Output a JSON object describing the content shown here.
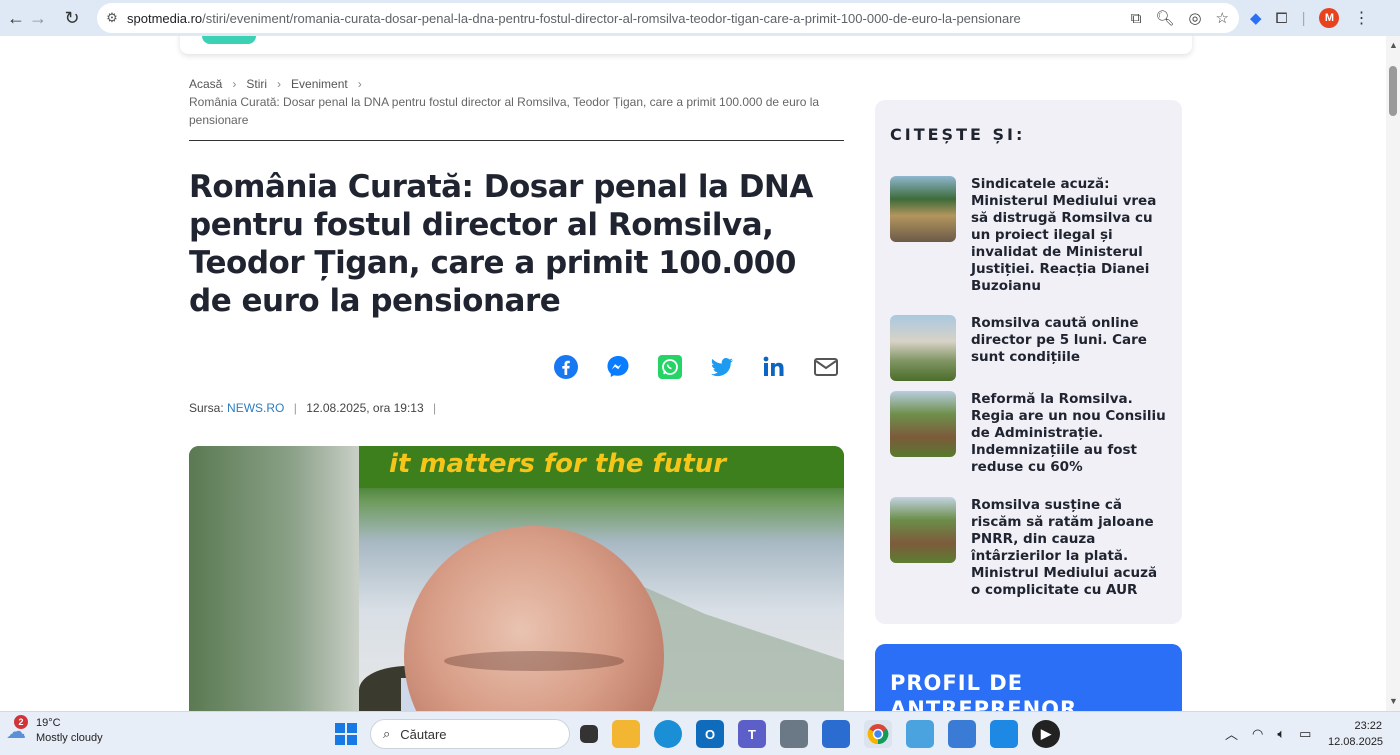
{
  "browser": {
    "url_host": "spotmedia.ro",
    "url_path": "/stiri/eveniment/romania-curata-dosar-penal-la-dna-pentru-fostul-director-al-romsilva-teodor-tigan-care-a-primit-100-000-de-euro-la-pensionare",
    "profile_initial": "M"
  },
  "breadcrumb": {
    "items": [
      "Acasă",
      "Stiri",
      "Eveniment"
    ],
    "separator": "›",
    "current": "România Curată: Dosar penal la DNA pentru fostul director al Romsilva, Teodor Țigan, care a primit 100.000 de euro la pensionare"
  },
  "article": {
    "title": "România Curată: Dosar penal la DNA pentru fostul director al Romsilva, Teodor Țigan, care a primit 100.000 de euro la pensionare",
    "source_label": "Sursa:",
    "source_name": "NEWS.RO",
    "date": "12.08.2025, ora 19:13",
    "image_banner_text": "it matters for the futur"
  },
  "share": {
    "icons": [
      "facebook-icon",
      "messenger-icon",
      "whatsapp-icon",
      "twitter-icon",
      "linkedin-icon",
      "email-icon"
    ],
    "colors": {
      "facebook": "#1877f2",
      "messenger": "#0a7cff",
      "whatsapp": "#25d366",
      "twitter": "#1d9bf0",
      "linkedin": "#0a66c2",
      "email": "#555555"
    }
  },
  "sidebar": {
    "heading": "CITEȘTE ȘI:",
    "items": [
      {
        "title": "Sindicatele acuză: Ministerul Mediului vrea să distrugă Romsilva cu un proiect ilegal și invalidat de Ministerul Justiției. Reacția Dianei Buzoianu"
      },
      {
        "title": "Romsilva caută online director pe 5 luni. Care sunt condițiile"
      },
      {
        "title": "Reformă la Romsilva. Regia are un nou Consiliu de Administrație. Indemnizațiile au fost reduse cu 60%"
      },
      {
        "title": "Romsilva susține că riscăm să ratăm jaloane PNRR, din cauza întârzierilor la plată. Ministrul Mediului acuză o complicitate cu AUR"
      }
    ],
    "profile_title": "PROFIL DE ANTREPRENOR"
  },
  "taskbar": {
    "weather_temp": "19°C",
    "weather_desc": "Mostly cloudy",
    "weather_badge": "2",
    "search_placeholder": "Căutare",
    "time": "23:22",
    "date": "12.08.2025"
  },
  "colors": {
    "accent_blue": "#2a6ff5",
    "title_text": "#1f2430",
    "source_link": "#2b7dc0"
  }
}
